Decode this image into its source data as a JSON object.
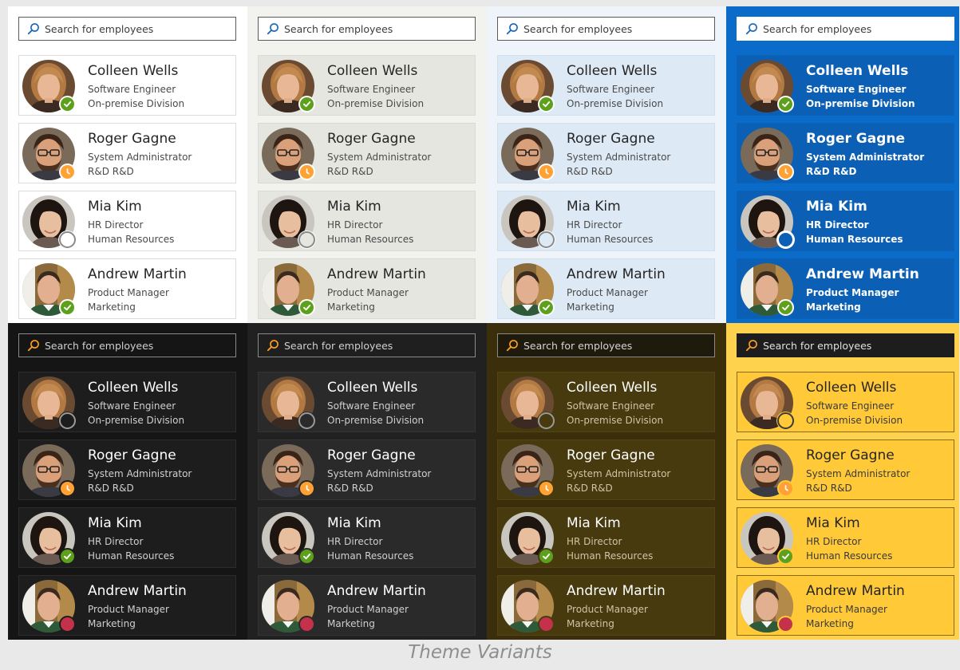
{
  "caption": "Theme Variants",
  "search": {
    "placeholder": "Search for employees",
    "icon": "search-icon"
  },
  "employees": [
    {
      "name": "Colleen Wells",
      "title": "Software Engineer",
      "department": "On-premise Division",
      "avatar": "woman-blonde"
    },
    {
      "name": "Roger Gagne",
      "title": "System Administrator",
      "department": "R&D R&D",
      "avatar": "man-beard-glasses"
    },
    {
      "name": "Mia Kim",
      "title": "HR Director",
      "department": "Human Resources",
      "avatar": "woman-dark-hair"
    },
    {
      "name": "Andrew Martin",
      "title": "Product Manager",
      "department": "Marketing",
      "avatar": "man-short-hair"
    }
  ],
  "status_colors": {
    "available": "#5ca01b",
    "away": "#ffa133",
    "offline": "transparent",
    "busy": "#c4314b"
  },
  "panels": [
    {
      "theme": "light",
      "bg": "#ffffff",
      "card_bg": "#ffffff",
      "card_border": "#dcdcdc",
      "text": "#252525",
      "subtext": "#4a4a4a",
      "search_bg": "#ffffff",
      "search_border": "#5a5a5a",
      "search_text": "#3c3c3c",
      "icon_color": "#1867b8",
      "badge_border": "#ffffff",
      "offline_ring": "#8a8a8a",
      "bold": false,
      "statuses": [
        "available",
        "away",
        "offline",
        "available"
      ]
    },
    {
      "theme": "light-gray",
      "bg": "#f2f2ef",
      "card_bg": "#e6e6e1",
      "card_border": "#dadad5",
      "text": "#252525",
      "subtext": "#4a4a4a",
      "search_bg": "#ffffff",
      "search_border": "#5a5a5a",
      "search_text": "#3c3c3c",
      "icon_color": "#1867b8",
      "badge_border": "#ffffff",
      "offline_ring": "#8a8a8a",
      "bold": false,
      "statuses": [
        "available",
        "away",
        "offline",
        "available"
      ]
    },
    {
      "theme": "light-blue",
      "bg": "#eef4f9",
      "card_bg": "#dde9f4",
      "card_border": "#d2e0ec",
      "text": "#252525",
      "subtext": "#4a4a4a",
      "search_bg": "#ffffff",
      "search_border": "#5a5a5a",
      "search_text": "#3c3c3c",
      "icon_color": "#1867b8",
      "badge_border": "#ffffff",
      "offline_ring": "#8a8a8a",
      "bold": false,
      "statuses": [
        "available",
        "away",
        "offline",
        "available"
      ]
    },
    {
      "theme": "accent-blue",
      "bg": "#0a6bc8",
      "card_bg": "#0b5fb4",
      "card_border": "#0a63bb",
      "text": "#ffffff",
      "subtext": "#ffffff",
      "search_bg": "#ffffff",
      "search_border": "#ffffff",
      "search_text": "#3c3c3c",
      "icon_color": "#1867b8",
      "badge_border": "#ffffff",
      "offline_ring": "#ffffff",
      "bold": true,
      "statuses": [
        "available",
        "away",
        "offline",
        "available"
      ]
    },
    {
      "theme": "dark",
      "bg": "#151515",
      "card_bg": "#1d1d1d",
      "card_border": "#2c2c2c",
      "text": "#ffffff",
      "subtext": "#cfcfcf",
      "search_bg": "#151515",
      "search_border": "#8a8a8a",
      "search_text": "#cfcfcf",
      "icon_color": "#ffa020",
      "badge_border": "#1d1d1d",
      "offline_ring": "#9a9a9a",
      "bold": false,
      "statuses": [
        "offline",
        "away",
        "available",
        "busy"
      ]
    },
    {
      "theme": "dark-gray",
      "bg": "#212121",
      "card_bg": "#2a2a2a",
      "card_border": "#343434",
      "text": "#ffffff",
      "subtext": "#cfcfcf",
      "search_bg": "#1f1f1f",
      "search_border": "#8a8a8a",
      "search_text": "#cfcfcf",
      "icon_color": "#ffa020",
      "badge_border": "#2a2a2a",
      "offline_ring": "#9a9a9a",
      "bold": false,
      "statuses": [
        "offline",
        "away",
        "available",
        "busy"
      ]
    },
    {
      "theme": "dark-amber",
      "bg": "#3a2f0a",
      "card_bg": "#463a0e",
      "card_border": "#524514",
      "text": "#ffffff",
      "subtext": "#cfc5a6",
      "search_bg": "#1e1a0c",
      "search_border": "#8a8a8a",
      "search_text": "#d4d4d4",
      "icon_color": "#ffa020",
      "badge_border": "#463a0e",
      "offline_ring": "#9a9a9a",
      "bold": false,
      "statuses": [
        "offline",
        "away",
        "available",
        "busy"
      ]
    },
    {
      "theme": "accent-yellow",
      "bg": "#ffd24d",
      "card_bg": "#ffc938",
      "card_border": "#8a6a10",
      "text": "#252525",
      "subtext": "#3a3a3a",
      "search_bg": "#1d1d1d",
      "search_border": "#1d1d1d",
      "search_text": "#e0e0e0",
      "icon_color": "#ffa020",
      "badge_border": "#ffc938",
      "offline_ring": "#3a3a3a",
      "bold": false,
      "statuses": [
        "offline",
        "away",
        "available",
        "busy"
      ]
    }
  ]
}
